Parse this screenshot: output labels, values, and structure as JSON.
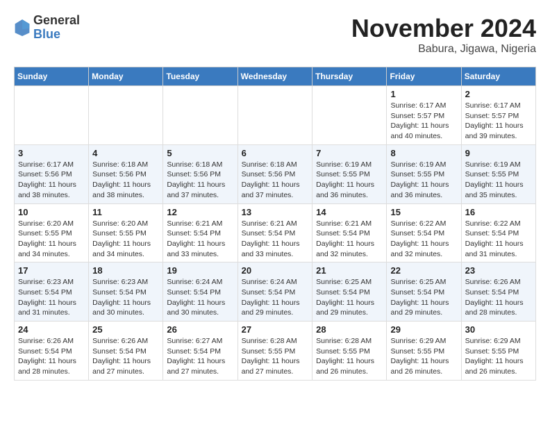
{
  "logo": {
    "general": "General",
    "blue": "Blue"
  },
  "header": {
    "month": "November 2024",
    "location": "Babura, Jigawa, Nigeria"
  },
  "weekdays": [
    "Sunday",
    "Monday",
    "Tuesday",
    "Wednesday",
    "Thursday",
    "Friday",
    "Saturday"
  ],
  "weeks": [
    [
      {
        "day": "",
        "info": ""
      },
      {
        "day": "",
        "info": ""
      },
      {
        "day": "",
        "info": ""
      },
      {
        "day": "",
        "info": ""
      },
      {
        "day": "",
        "info": ""
      },
      {
        "day": "1",
        "info": "Sunrise: 6:17 AM\nSunset: 5:57 PM\nDaylight: 11 hours\nand 40 minutes."
      },
      {
        "day": "2",
        "info": "Sunrise: 6:17 AM\nSunset: 5:57 PM\nDaylight: 11 hours\nand 39 minutes."
      }
    ],
    [
      {
        "day": "3",
        "info": "Sunrise: 6:17 AM\nSunset: 5:56 PM\nDaylight: 11 hours\nand 38 minutes."
      },
      {
        "day": "4",
        "info": "Sunrise: 6:18 AM\nSunset: 5:56 PM\nDaylight: 11 hours\nand 38 minutes."
      },
      {
        "day": "5",
        "info": "Sunrise: 6:18 AM\nSunset: 5:56 PM\nDaylight: 11 hours\nand 37 minutes."
      },
      {
        "day": "6",
        "info": "Sunrise: 6:18 AM\nSunset: 5:56 PM\nDaylight: 11 hours\nand 37 minutes."
      },
      {
        "day": "7",
        "info": "Sunrise: 6:19 AM\nSunset: 5:55 PM\nDaylight: 11 hours\nand 36 minutes."
      },
      {
        "day": "8",
        "info": "Sunrise: 6:19 AM\nSunset: 5:55 PM\nDaylight: 11 hours\nand 36 minutes."
      },
      {
        "day": "9",
        "info": "Sunrise: 6:19 AM\nSunset: 5:55 PM\nDaylight: 11 hours\nand 35 minutes."
      }
    ],
    [
      {
        "day": "10",
        "info": "Sunrise: 6:20 AM\nSunset: 5:55 PM\nDaylight: 11 hours\nand 34 minutes."
      },
      {
        "day": "11",
        "info": "Sunrise: 6:20 AM\nSunset: 5:55 PM\nDaylight: 11 hours\nand 34 minutes."
      },
      {
        "day": "12",
        "info": "Sunrise: 6:21 AM\nSunset: 5:54 PM\nDaylight: 11 hours\nand 33 minutes."
      },
      {
        "day": "13",
        "info": "Sunrise: 6:21 AM\nSunset: 5:54 PM\nDaylight: 11 hours\nand 33 minutes."
      },
      {
        "day": "14",
        "info": "Sunrise: 6:21 AM\nSunset: 5:54 PM\nDaylight: 11 hours\nand 32 minutes."
      },
      {
        "day": "15",
        "info": "Sunrise: 6:22 AM\nSunset: 5:54 PM\nDaylight: 11 hours\nand 32 minutes."
      },
      {
        "day": "16",
        "info": "Sunrise: 6:22 AM\nSunset: 5:54 PM\nDaylight: 11 hours\nand 31 minutes."
      }
    ],
    [
      {
        "day": "17",
        "info": "Sunrise: 6:23 AM\nSunset: 5:54 PM\nDaylight: 11 hours\nand 31 minutes."
      },
      {
        "day": "18",
        "info": "Sunrise: 6:23 AM\nSunset: 5:54 PM\nDaylight: 11 hours\nand 30 minutes."
      },
      {
        "day": "19",
        "info": "Sunrise: 6:24 AM\nSunset: 5:54 PM\nDaylight: 11 hours\nand 30 minutes."
      },
      {
        "day": "20",
        "info": "Sunrise: 6:24 AM\nSunset: 5:54 PM\nDaylight: 11 hours\nand 29 minutes."
      },
      {
        "day": "21",
        "info": "Sunrise: 6:25 AM\nSunset: 5:54 PM\nDaylight: 11 hours\nand 29 minutes."
      },
      {
        "day": "22",
        "info": "Sunrise: 6:25 AM\nSunset: 5:54 PM\nDaylight: 11 hours\nand 29 minutes."
      },
      {
        "day": "23",
        "info": "Sunrise: 6:26 AM\nSunset: 5:54 PM\nDaylight: 11 hours\nand 28 minutes."
      }
    ],
    [
      {
        "day": "24",
        "info": "Sunrise: 6:26 AM\nSunset: 5:54 PM\nDaylight: 11 hours\nand 28 minutes."
      },
      {
        "day": "25",
        "info": "Sunrise: 6:26 AM\nSunset: 5:54 PM\nDaylight: 11 hours\nand 27 minutes."
      },
      {
        "day": "26",
        "info": "Sunrise: 6:27 AM\nSunset: 5:54 PM\nDaylight: 11 hours\nand 27 minutes."
      },
      {
        "day": "27",
        "info": "Sunrise: 6:28 AM\nSunset: 5:55 PM\nDaylight: 11 hours\nand 27 minutes."
      },
      {
        "day": "28",
        "info": "Sunrise: 6:28 AM\nSunset: 5:55 PM\nDaylight: 11 hours\nand 26 minutes."
      },
      {
        "day": "29",
        "info": "Sunrise: 6:29 AM\nSunset: 5:55 PM\nDaylight: 11 hours\nand 26 minutes."
      },
      {
        "day": "30",
        "info": "Sunrise: 6:29 AM\nSunset: 5:55 PM\nDaylight: 11 hours\nand 26 minutes."
      }
    ]
  ]
}
